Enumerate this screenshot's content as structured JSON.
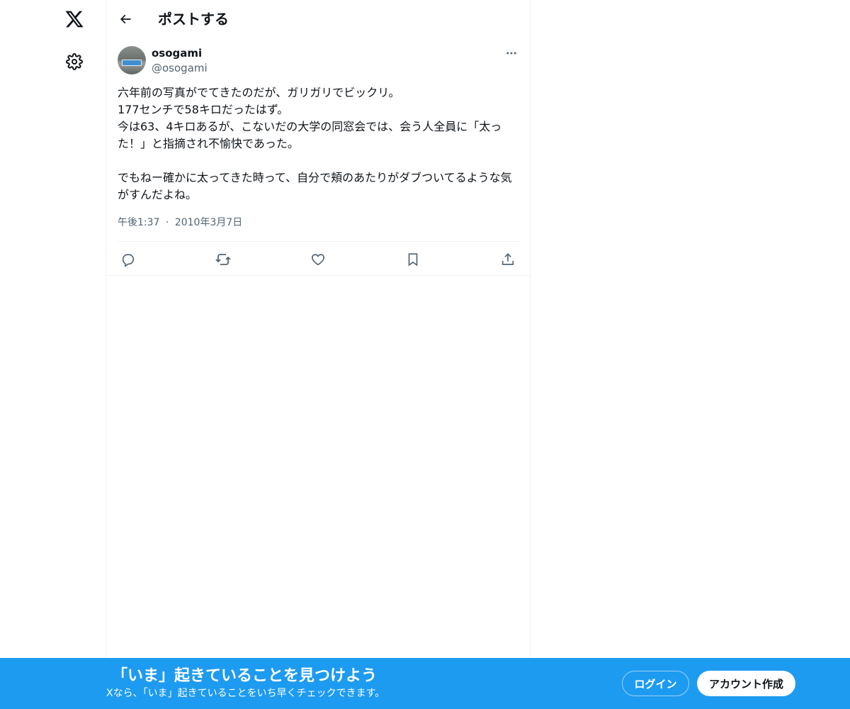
{
  "nav": {
    "logo_icon": "x-logo-icon",
    "settings_icon": "gear-icon"
  },
  "header": {
    "back_icon": "arrow-left-icon",
    "title": "ポストする"
  },
  "post": {
    "display_name": "osogami",
    "handle": "@osogami",
    "more_icon": "more-horizontal-icon",
    "text": "六年前の写真がでてきたのだが、ガリガリでビックリ。\n177センチで58キロだったはず。\n今は63、4キロあるが、こないだの大学の同窓会では、会う人全員に「太った！」と指摘され不愉快であった。\n\nでもねー確かに太ってきた時って、自分で頬のあたりがダブついてるような気がすんだよね。",
    "time": "午後1:37",
    "separator": "·",
    "date": "2010年3月7日",
    "actions": {
      "reply_icon": "reply-icon",
      "repost_icon": "repost-icon",
      "like_icon": "heart-icon",
      "bookmark_icon": "bookmark-icon",
      "share_icon": "share-icon"
    }
  },
  "banner": {
    "title": "「いま」起きていることを見つけよう",
    "subtitle": "Xなら、「いま」起きていることをいち早くチェックできます。",
    "login_label": "ログイン",
    "signup_label": "アカウント作成"
  },
  "colors": {
    "accent": "#1d9bf0",
    "text_primary": "#0f1419",
    "text_secondary": "#536471",
    "divider": "#eff3f4"
  }
}
